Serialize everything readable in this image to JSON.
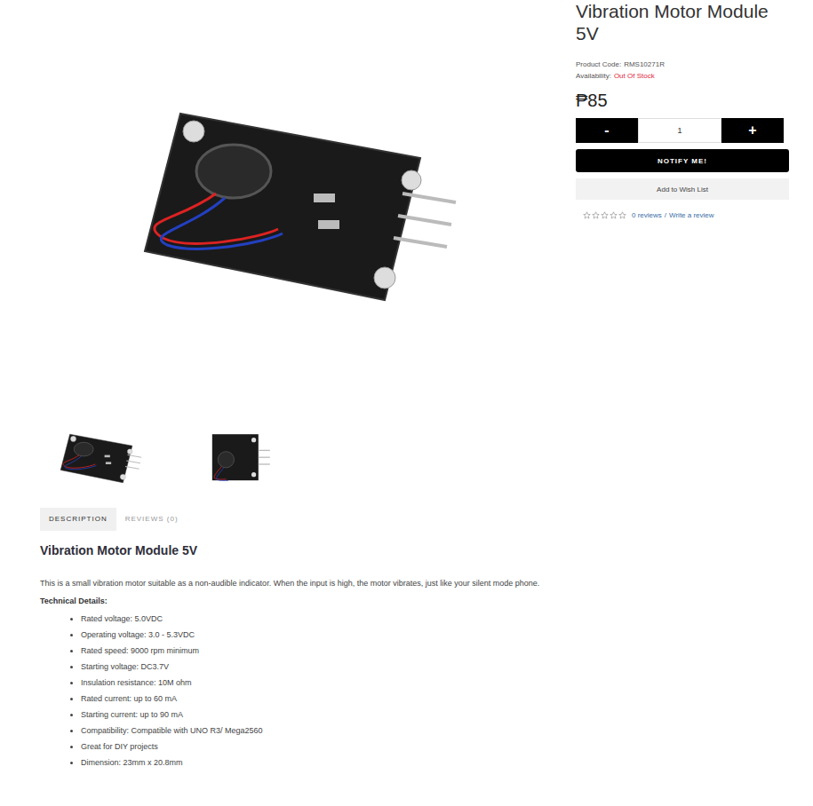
{
  "product": {
    "title": "Vibration Motor Module 5V",
    "code_label": "Product Code:",
    "code": "RMS10271R",
    "availability_label": "Availability:",
    "availability": "Out Of Stock",
    "price": "₱85",
    "minus": "-",
    "quantity": "1",
    "plus": "+",
    "notify_button": "NOTIFY ME!",
    "wishlist_button": "Add to Wish List",
    "stars": 0,
    "reviews_link": "0 reviews",
    "separator": "/",
    "write_review": "Write a review"
  },
  "gallery": {
    "thumbnails": [
      {
        "kind": "angled"
      },
      {
        "kind": "top"
      }
    ]
  },
  "tabs": [
    {
      "label": "DESCRIPTION",
      "selected": true
    },
    {
      "label": "REVIEWS (0)",
      "selected": false
    }
  ],
  "description": {
    "heading": "Vibration Motor Module 5V",
    "intro": "This is a small vibration motor suitable as a non-audible indicator. When the input is high, the motor vibrates, just like your silent mode phone.",
    "details_label": "Technical Details:",
    "specs": [
      "Rated voltage: 5.0VDC",
      "Operating voltage: 3.0 - 5.3VDC",
      "Rated speed: 9000 rpm minimum",
      "Starting voltage: DC3.7V",
      "Insulation resistance: 10M ohm",
      "Rated current: up to 60 mA",
      "Starting current: up to 90 mA",
      "Compatibility: Compatible with UNO R3/ Mega2560",
      "Great for DIY projects",
      "Dimension: 23mm x 20.8mm"
    ]
  }
}
